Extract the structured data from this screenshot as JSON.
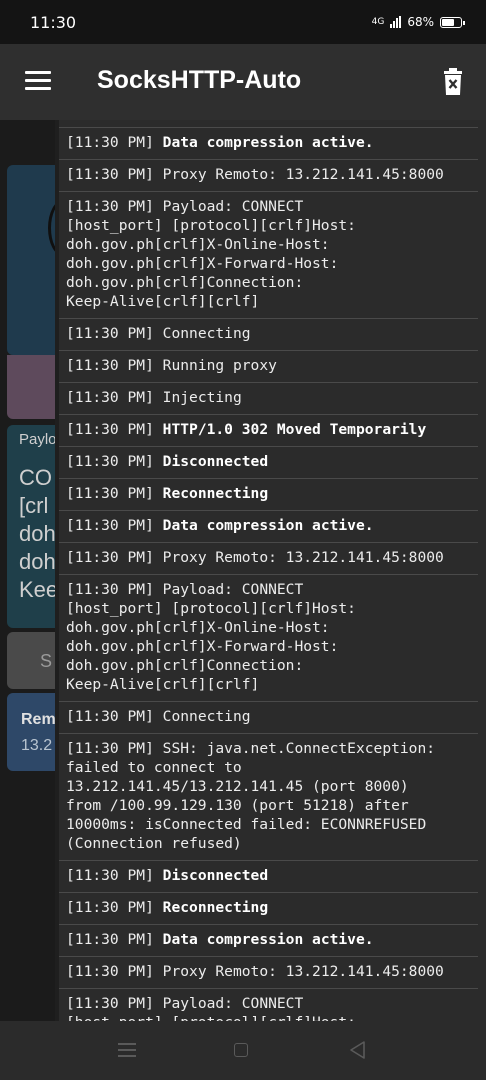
{
  "status_bar": {
    "time": "11:30",
    "network": "4G",
    "battery": "68%"
  },
  "app_bar": {
    "title": "SocksHTTP-Auto",
    "menu_icon": "hamburger-menu-icon",
    "clear_icon": "delete-log-icon"
  },
  "background": {
    "payload_label": "Paylo",
    "payload_lines": [
      "CO",
      "[crl",
      "doh",
      "doh",
      "Kee"
    ],
    "button_label": "S",
    "remote_label": "Rem",
    "remote_value": "13.2"
  },
  "logs": [
    {
      "time": "[11:30 PM]",
      "message": "Data compression active.",
      "bold": true
    },
    {
      "time": "[11:30 PM]",
      "message": "Proxy Remoto: 13.212.141.45:8000",
      "bold": false
    },
    {
      "time": "[11:30 PM]",
      "message": "Payload: CONNECT\n[host_port] [protocol][crlf]Host:\ndoh.gov.ph[crlf]X-Online-Host:\ndoh.gov.ph[crlf]X-Forward-Host:\ndoh.gov.ph[crlf]Connection:\nKeep-Alive[crlf][crlf]",
      "bold": false
    },
    {
      "time": "[11:30 PM]",
      "message": "Connecting",
      "bold": false
    },
    {
      "time": "[11:30 PM]",
      "message": "Running proxy",
      "bold": false
    },
    {
      "time": "[11:30 PM]",
      "message": "Injecting",
      "bold": false
    },
    {
      "time": "[11:30 PM]",
      "message": "HTTP/1.0 302 Moved Temporarily",
      "bold": true
    },
    {
      "time": "[11:30 PM]",
      "message": "Disconnected",
      "bold": true
    },
    {
      "time": "[11:30 PM]",
      "message": "Reconnecting",
      "bold": true
    },
    {
      "time": "[11:30 PM]",
      "message": "Data compression active.",
      "bold": true
    },
    {
      "time": "[11:30 PM]",
      "message": "Proxy Remoto: 13.212.141.45:8000",
      "bold": false
    },
    {
      "time": "[11:30 PM]",
      "message": "Payload: CONNECT\n[host_port] [protocol][crlf]Host:\ndoh.gov.ph[crlf]X-Online-Host:\ndoh.gov.ph[crlf]X-Forward-Host:\ndoh.gov.ph[crlf]Connection:\nKeep-Alive[crlf][crlf]",
      "bold": false
    },
    {
      "time": "[11:30 PM]",
      "message": "Connecting",
      "bold": false
    },
    {
      "time": "[11:30 PM]",
      "message": "SSH: java.net.ConnectException:\nfailed to connect to\n13.212.141.45/13.212.141.45 (port 8000)\nfrom /100.99.129.130 (port 51218) after\n10000ms: isConnected failed: ECONNREFUSED\n(Connection refused)",
      "bold": false
    },
    {
      "time": "[11:30 PM]",
      "message": "Disconnected",
      "bold": true
    },
    {
      "time": "[11:30 PM]",
      "message": "Reconnecting",
      "bold": true
    },
    {
      "time": "[11:30 PM]",
      "message": "Data compression active.",
      "bold": true
    },
    {
      "time": "[11:30 PM]",
      "message": "Proxy Remoto: 13.212.141.45:8000",
      "bold": false
    },
    {
      "time": "[11:30 PM]",
      "message": "Payload: CONNECT\n[host_port] [protocol][crlf]Host:\ndoh.gov.ph[crlf]X-Online-Host:",
      "bold": false
    }
  ],
  "nav_bar": {
    "icons": [
      "recent-apps-icon",
      "home-icon",
      "back-icon"
    ]
  }
}
